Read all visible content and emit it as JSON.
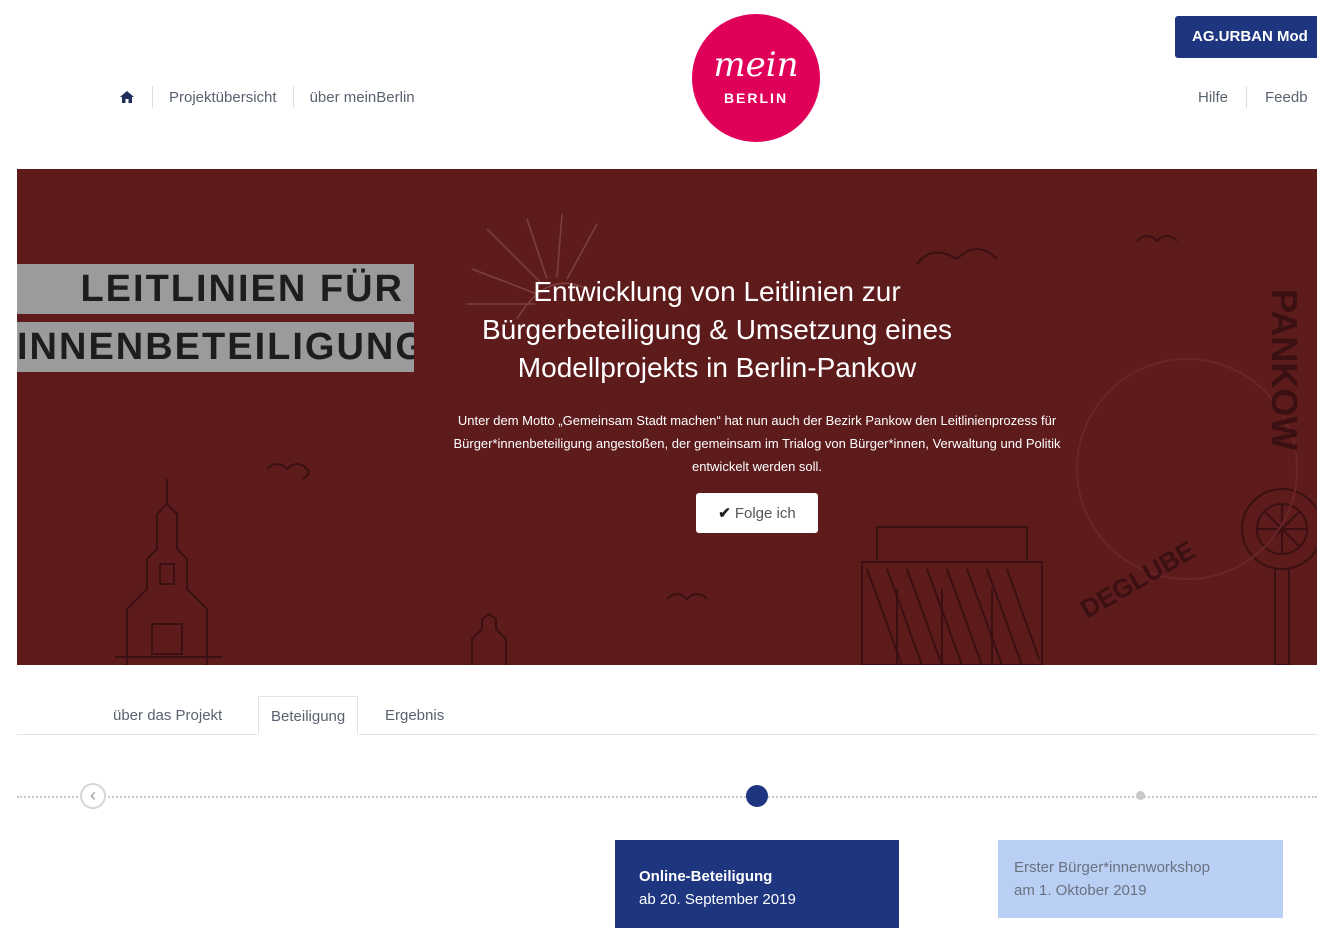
{
  "header": {
    "nav": [
      {
        "label": "Projektübersicht"
      },
      {
        "label": "über meinBerlin"
      }
    ],
    "logo": {
      "script": "mein",
      "word": "BERLIN"
    },
    "org_button": "AG.URBAN Mod",
    "right_nav": [
      {
        "label": "Hilfe"
      },
      {
        "label": "Feedb"
      }
    ]
  },
  "hero": {
    "banner_lines": [
      "LEITLINIEN FÜR",
      "INNENBETEILIGUNG"
    ],
    "title": "Entwicklung von Leitlinien zur Bürgerbeteiligung & Umsetzung eines Modellprojekts in Berlin-Pankow",
    "description": "Unter dem Motto „Gemeinsam Stadt machen“ hat nun auch der Bezirk Pankow den Leitlinienprozess für Bürger*innenbeteiligung angestoßen, der gemeinsam im Trialog von Bürger*innen, Verwaltung und Politik entwickelt werden soll.",
    "follow_button": "Folge ich",
    "art_text": [
      "PANKOW",
      "DEGLUBE"
    ]
  },
  "tabs": [
    {
      "label": "über das Projekt",
      "active": false
    },
    {
      "label": "Beteiligung",
      "active": true
    },
    {
      "label": "Ergebnis",
      "active": false
    }
  ],
  "timeline": {
    "phases": [
      {
        "title": "Online-Beteiligung",
        "date": "ab 20. September 2019",
        "active": true
      },
      {
        "title": "Erster Bürger*innenworkshop",
        "date": "am 1. Oktober 2019",
        "active": false
      }
    ]
  },
  "colors": {
    "brand_pink": "#e0005a",
    "navy": "#1e3580",
    "hero_bg": "#5e1b1c",
    "phase_light": "#b9cff3"
  }
}
